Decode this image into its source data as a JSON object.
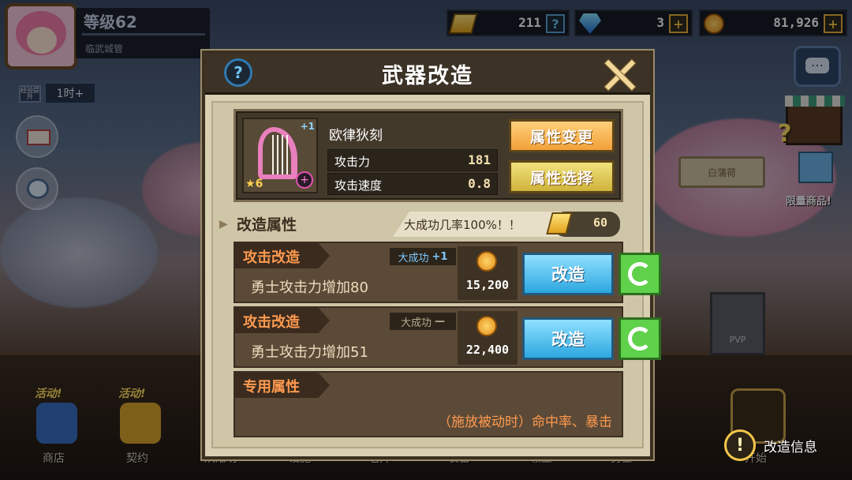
{
  "player": {
    "level": "等级62",
    "title": "临武城管",
    "boost_label": "经验提升",
    "boost_time": "1时+"
  },
  "currency": {
    "tickets": "211",
    "gems": "3",
    "gold": "81,926"
  },
  "scene": {
    "sign_text": "白蒲荷",
    "limited_label": "限量商品!",
    "pvp_label": "PVP"
  },
  "modal": {
    "title": "武器改造",
    "help_icon": "?",
    "weapon": {
      "name": "欧律狄刻",
      "plus": "+1",
      "stars": "6",
      "stats": [
        {
          "label": "攻击力",
          "value": "181"
        },
        {
          "label": "攻击速度",
          "value": "0.8"
        }
      ],
      "change_button": "属性变更",
      "select_button": "属性选择"
    },
    "section": {
      "title": "改造属性",
      "success_text": "大成功几率100%！！",
      "ticket_cost": "60"
    },
    "rows": [
      {
        "label": "攻击改造",
        "badge_text": "大成功",
        "badge_value": "+1",
        "desc": "勇士攻击力增加80",
        "cost": "15,200",
        "button": "改造"
      },
      {
        "label": "攻击改造",
        "badge_text": "大成功",
        "badge_value": "—",
        "desc": "勇士攻击力增加51",
        "cost": "22,400",
        "button": "改造"
      }
    ],
    "exclusive": {
      "label": "专用属性",
      "text": "（施放被动时）命中率、暴击"
    }
  },
  "nav": {
    "items": [
      {
        "label": "商店",
        "tag": "活动!"
      },
      {
        "label": "契约",
        "tag": "活动!"
      },
      {
        "label": "烘焙坊",
        "tag": ""
      },
      {
        "label": "设施",
        "tag": ""
      },
      {
        "label": "仓库",
        "tag": ""
      },
      {
        "label": "装备",
        "tag": ""
      },
      {
        "label": "领主",
        "tag": ""
      },
      {
        "label": "勇士",
        "tag": ""
      },
      {
        "label": "开始",
        "tag": ""
      }
    ]
  },
  "info_button": "改造信息",
  "colors": {
    "accent_orange": "#ff9a4f",
    "button_blue": "#2da7e0",
    "button_green": "#5fd14a",
    "modal_bg": "#d9cfb2"
  }
}
